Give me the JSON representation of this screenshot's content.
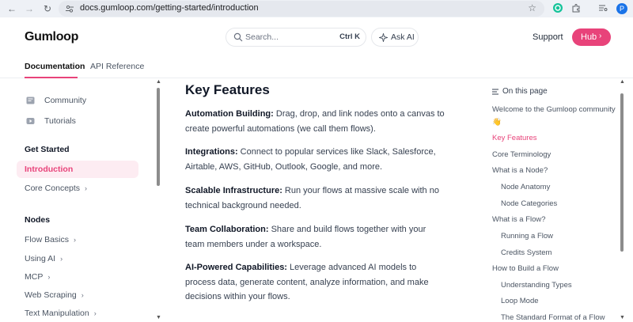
{
  "browser": {
    "url": "docs.gumloop.com/getting-started/introduction",
    "profile_initial": "P"
  },
  "header": {
    "logo": "Gumloop",
    "search_placeholder": "Search...",
    "search_shortcut": "Ctrl K",
    "ask_ai": "Ask AI",
    "support": "Support",
    "hub": "Hub"
  },
  "tabs": {
    "documentation": "Documentation",
    "api_reference": "API Reference"
  },
  "sidebar": {
    "links": [
      {
        "label": "Community",
        "icon": "community-icon"
      },
      {
        "label": "Tutorials",
        "icon": "youtube-icon"
      }
    ],
    "get_started": {
      "heading": "Get Started",
      "items": [
        "Introduction",
        "Core Concepts"
      ]
    },
    "nodes": {
      "heading": "Nodes",
      "items": [
        "Flow Basics",
        "Using AI",
        "MCP",
        "Web Scraping",
        "Text Manipulation"
      ]
    }
  },
  "main": {
    "title": "Key Features",
    "features": [
      {
        "title": "Automation Building:",
        "text": " Drag, drop, and link nodes onto a canvas to create powerful automations (we call them flows)."
      },
      {
        "title": "Integrations:",
        "text": " Connect to popular services like Slack, Salesforce, Airtable, AWS, GitHub, Outlook, Google, and more."
      },
      {
        "title": "Scalable Infrastructure:",
        "text": " Run your flows at massive scale with no technical background needed."
      },
      {
        "title": "Team Collaboration:",
        "text": " Share and build flows together with your team members under a workspace."
      },
      {
        "title": "AI-Powered Capabilities:",
        "text": " Leverage advanced AI models to process data, generate content, analyze information, and make decisions within your flows."
      }
    ]
  },
  "toc": {
    "heading": "On this page",
    "items": [
      {
        "label": "Welcome to the Gumloop community",
        "level": 1
      },
      {
        "label": "👋",
        "level": 1
      },
      {
        "label": "Key Features",
        "level": 1,
        "active": true
      },
      {
        "label": "Core Terminology",
        "level": 1
      },
      {
        "label": "What is a Node?",
        "level": 1
      },
      {
        "label": "Node Anatomy",
        "level": 2
      },
      {
        "label": "Node Categories",
        "level": 2
      },
      {
        "label": "What is a Flow?",
        "level": 1
      },
      {
        "label": "Running a Flow",
        "level": 2
      },
      {
        "label": "Credits System",
        "level": 2
      },
      {
        "label": "How to Build a Flow",
        "level": 1
      },
      {
        "label": "Understanding Types",
        "level": 2
      },
      {
        "label": "Loop Mode",
        "level": 2
      },
      {
        "label": "The Standard Format of a Flow",
        "level": 2
      }
    ]
  },
  "colors": {
    "accent": "#e8437a",
    "active_bg": "#fdecf2"
  }
}
